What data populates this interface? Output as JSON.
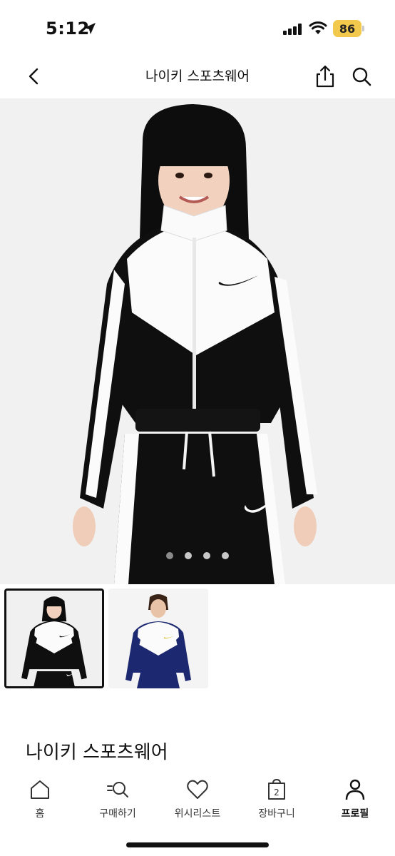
{
  "status_bar": {
    "time": "5:12",
    "battery": "86",
    "battery_color": "#f2c94c"
  },
  "header": {
    "title": "나이키 스포츠웨어",
    "back_icon": "chevron-left-icon",
    "share_icon": "share-icon",
    "search_icon": "search-icon"
  },
  "gallery": {
    "image_count": 4,
    "active_index": 0,
    "thumbnails": [
      {
        "variant": "black-white",
        "selected": true
      },
      {
        "variant": "navy-white",
        "selected": false
      }
    ]
  },
  "product": {
    "brand_name": "나이키 스포츠웨어"
  },
  "bottom_nav": {
    "items": [
      {
        "label": "홈",
        "icon": "home-icon"
      },
      {
        "label": "구매하기",
        "icon": "search-list-icon"
      },
      {
        "label": "위시리스트",
        "icon": "heart-icon"
      },
      {
        "label": "장바구니",
        "icon": "bag-icon",
        "badge": "2"
      },
      {
        "label": "프로필",
        "icon": "profile-icon",
        "active": true
      }
    ]
  }
}
